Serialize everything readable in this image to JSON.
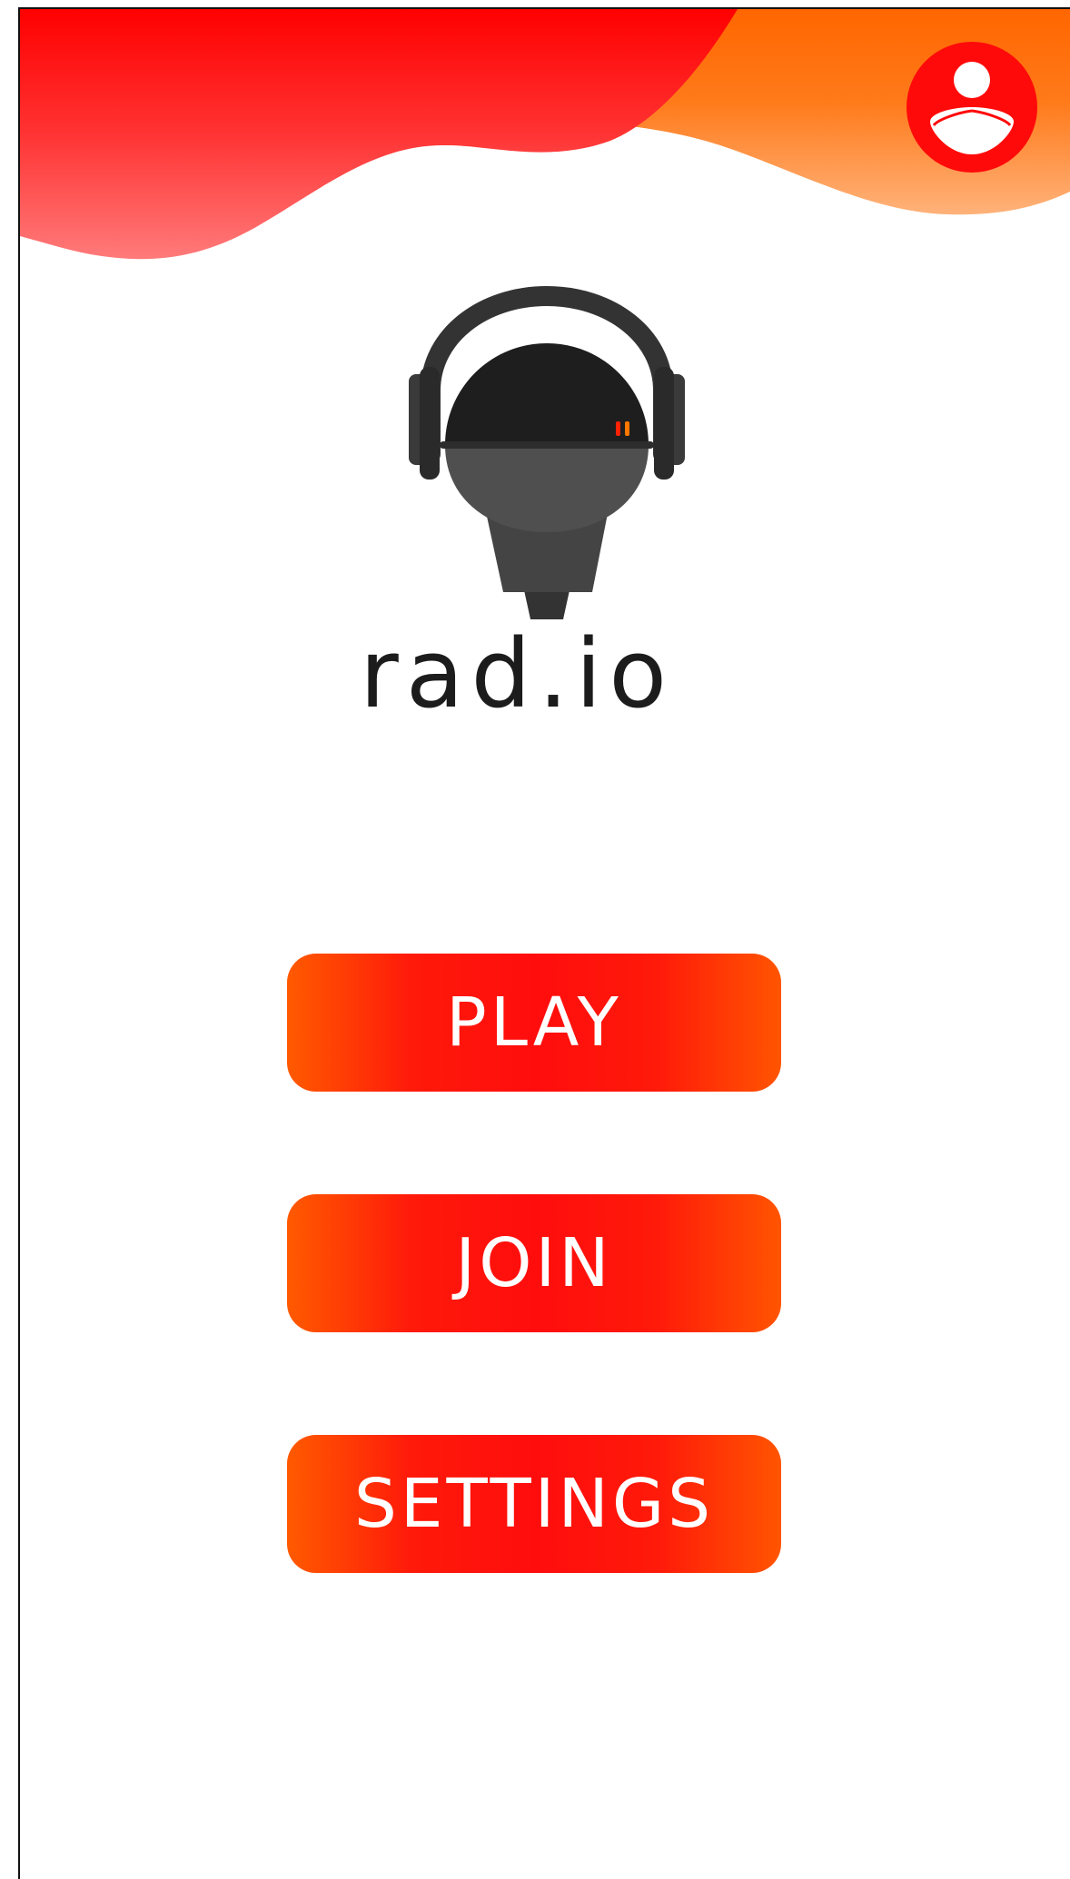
{
  "app": {
    "title": "rad.io"
  },
  "menu": {
    "play_label": "PLAY",
    "join_label": "JOIN",
    "settings_label": "SETTINGS"
  },
  "icons": {
    "profile": "user-avatar-icon",
    "logo": "microphone-headphones-icon"
  },
  "colors": {
    "accent_red": "#ff0000",
    "accent_orange": "#ff6600",
    "button_text": "#ffffff",
    "title_text": "#1c1c1c"
  }
}
